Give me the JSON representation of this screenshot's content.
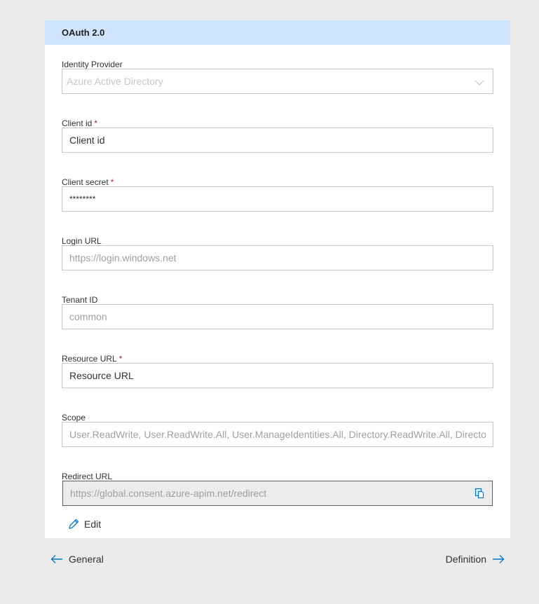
{
  "colors": {
    "header_bg": "#cfe4fc",
    "accent": "#0078d4",
    "required": "#a4262c"
  },
  "panel": {
    "title": "OAuth 2.0"
  },
  "fields": {
    "identity_provider": {
      "label": "Identity Provider",
      "value": "Azure Active Directory",
      "icon": "chevron-down-icon"
    },
    "client_id": {
      "label": "Client id",
      "required_mark": "*",
      "value": "Client id"
    },
    "client_secret": {
      "label": "Client secret",
      "required_mark": "*",
      "value": "********"
    },
    "login_url": {
      "label": "Login URL",
      "placeholder": "https://login.windows.net"
    },
    "tenant_id": {
      "label": "Tenant ID",
      "placeholder": "common"
    },
    "resource_url": {
      "label": "Resource URL",
      "required_mark": "*",
      "value": "Resource URL"
    },
    "scope": {
      "label": "Scope",
      "placeholder": "User.ReadWrite, User.ReadWrite.All, User.ManageIdentities.All, Directory.ReadWrite.All, Directory.AccessAsUser.All"
    },
    "redirect_url": {
      "label": "Redirect URL",
      "value": "https://global.consent.azure-apim.net/redirect",
      "icon": "copy-icon"
    }
  },
  "edit": {
    "label": "Edit",
    "icon": "pencil-icon"
  },
  "navigation": {
    "previous": {
      "label": "General",
      "icon": "arrow-left-icon"
    },
    "next": {
      "label": "Definition",
      "icon": "arrow-right-icon"
    }
  }
}
